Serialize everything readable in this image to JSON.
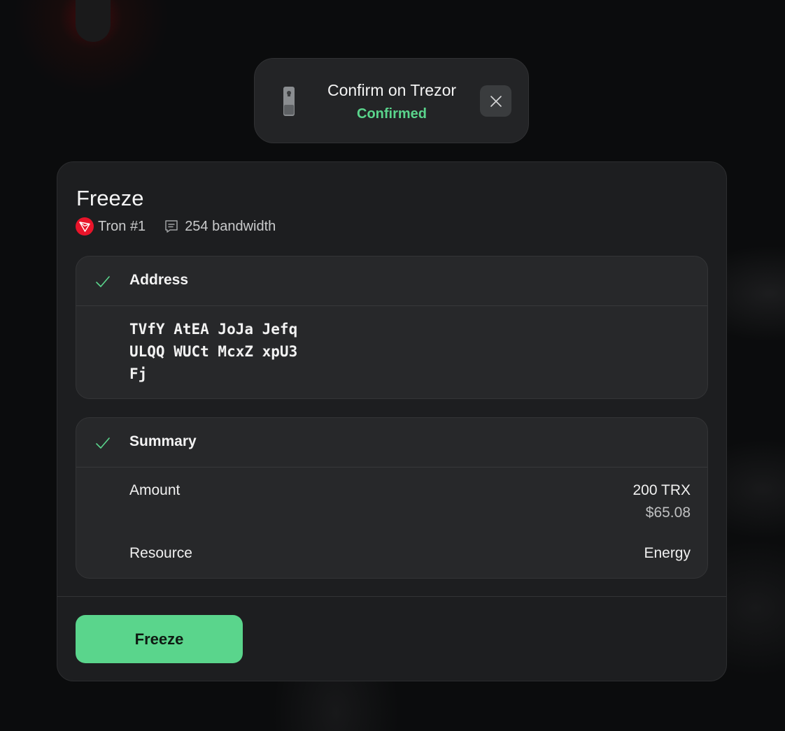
{
  "toast": {
    "title": "Confirm on Trezor",
    "status": "Confirmed",
    "icons": {
      "device": "trezor-device-icon",
      "close": "close-icon"
    },
    "status_color": "#5ad58c"
  },
  "card": {
    "title": "Freeze",
    "account": "Tron #1",
    "fee": "254 bandwidth",
    "icons": {
      "account": "tron-icon",
      "fee": "receipt-icon"
    }
  },
  "address_section": {
    "title": "Address",
    "lines": [
      "TVfY AtEA JoJa Jefq",
      "ULQQ WUCt McxZ xpU3",
      "Fj"
    ]
  },
  "summary_section": {
    "title": "Summary",
    "rows": [
      {
        "label": "Amount",
        "value": "200 TRX",
        "sub": "$65.08"
      },
      {
        "label": "Resource",
        "value": "Energy"
      }
    ]
  },
  "action": {
    "label": "Freeze",
    "color": "#5ad58c"
  }
}
